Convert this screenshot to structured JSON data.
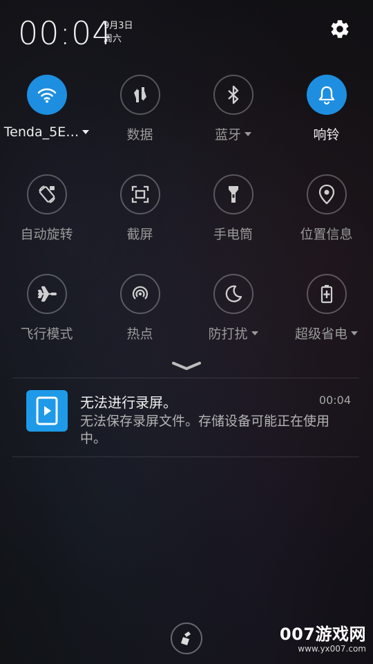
{
  "status": {
    "time": "00:04",
    "date": "9月3日",
    "weekday": "周六"
  },
  "quick_settings": [
    {
      "label": "Tenda_5E…",
      "icon": "wifi-icon",
      "active": true,
      "dropdown": true
    },
    {
      "label": "数据",
      "icon": "mobile-data-icon",
      "active": false,
      "dropdown": false
    },
    {
      "label": "蓝牙",
      "icon": "bluetooth-icon",
      "active": false,
      "dropdown": true
    },
    {
      "label": "响铃",
      "icon": "bell-icon",
      "active": true,
      "dropdown": false
    },
    {
      "label": "自动旋转",
      "icon": "auto-rotate-icon",
      "active": false,
      "dropdown": false
    },
    {
      "label": "截屏",
      "icon": "screenshot-icon",
      "active": false,
      "dropdown": false
    },
    {
      "label": "手电筒",
      "icon": "flashlight-icon",
      "active": false,
      "dropdown": false
    },
    {
      "label": "位置信息",
      "icon": "location-icon",
      "active": false,
      "dropdown": false
    },
    {
      "label": "飞行模式",
      "icon": "airplane-icon",
      "active": false,
      "dropdown": false
    },
    {
      "label": "热点",
      "icon": "hotspot-icon",
      "active": false,
      "dropdown": false
    },
    {
      "label": "防打扰",
      "icon": "moon-icon",
      "active": false,
      "dropdown": true
    },
    {
      "label": "超级省电",
      "icon": "battery-saver-icon",
      "active": false,
      "dropdown": true
    }
  ],
  "notification": {
    "title": "无法进行录屏。",
    "time": "00:04",
    "body": "无法保存录屏文件。存储设备可能正在使用中。",
    "icon": "screen-record-icon"
  },
  "watermark": {
    "main": "007游戏网",
    "url": "www.yx007.com"
  },
  "colors": {
    "accent": "#1e8fe0",
    "background": "#0f0f12"
  }
}
